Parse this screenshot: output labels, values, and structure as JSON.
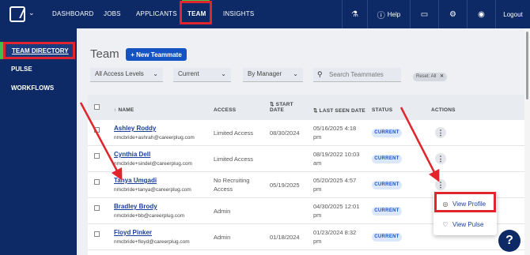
{
  "nav": {
    "items": [
      "DASHBOARD",
      "JOBS",
      "APPLICANTS",
      "TEAM",
      "INSIGHTS"
    ],
    "help_label": "Help",
    "logout_label": "Logout"
  },
  "sidebar": {
    "items": [
      "TEAM DIRECTORY",
      "PULSE",
      "WORKFLOWS"
    ]
  },
  "page": {
    "title": "Team",
    "new_button": "+ New Teammate"
  },
  "filters": {
    "access": "All Access Levels",
    "status": "Current",
    "manager": "By Manager",
    "search_placeholder": "Search Teammates",
    "reset": "Reset: All"
  },
  "table": {
    "headers": {
      "name": "NAME",
      "access": "ACCESS",
      "start_line1": "START",
      "start_line2": "DATE",
      "last_seen": "LAST SEEN DATE",
      "status": "STATUS",
      "actions": "ACTIONS"
    },
    "rows": [
      {
        "name": "Ashley Roddy",
        "email": "nmcbride+ashrah@careerplug.com",
        "access_line1": "Limited Access",
        "access_line2": "",
        "start": "08/30/2024",
        "last_seen_line1": "05/16/2025 4:18",
        "last_seen_line2": "pm",
        "status": "CURRENT"
      },
      {
        "name": "Cynthia Dell",
        "email": "nmcbride+sindel@careerplug.com",
        "access_line1": "Limited Access",
        "access_line2": "",
        "start": "",
        "last_seen_line1": "08/19/2022 10:03",
        "last_seen_line2": "am",
        "status": "CURRENT"
      },
      {
        "name": "Tanya Umgadi",
        "email": "nmcbride+tanya@careerplug.com",
        "access_line1": "No Recruiting",
        "access_line2": "Access",
        "start": "05/19/2025",
        "last_seen_line1": "05/20/2025 4:57",
        "last_seen_line2": "pm",
        "status": "CURRENT"
      },
      {
        "name": "Bradley Brody",
        "email": "nmcbride+bb@careerplug.com",
        "access_line1": "Admin",
        "access_line2": "",
        "start": "",
        "last_seen_line1": "04/30/2025 12:01",
        "last_seen_line2": "pm",
        "status": "CURRENT"
      },
      {
        "name": "Floyd Pinker",
        "email": "nmcbride+floyd@careerplug.com",
        "access_line1": "Admin",
        "access_line2": "",
        "start": "01/18/2024",
        "last_seen_line1": "01/23/2024 8:32",
        "last_seen_line2": "pm",
        "status": "CURRENT"
      }
    ]
  },
  "menu": {
    "view_profile": "View Profile",
    "view_pulse": "View Pulse"
  },
  "colors": {
    "navy": "#0d2a66",
    "highlight_red": "#e0262c",
    "active_green": "#3cc24a",
    "primary_blue": "#1553c2"
  }
}
